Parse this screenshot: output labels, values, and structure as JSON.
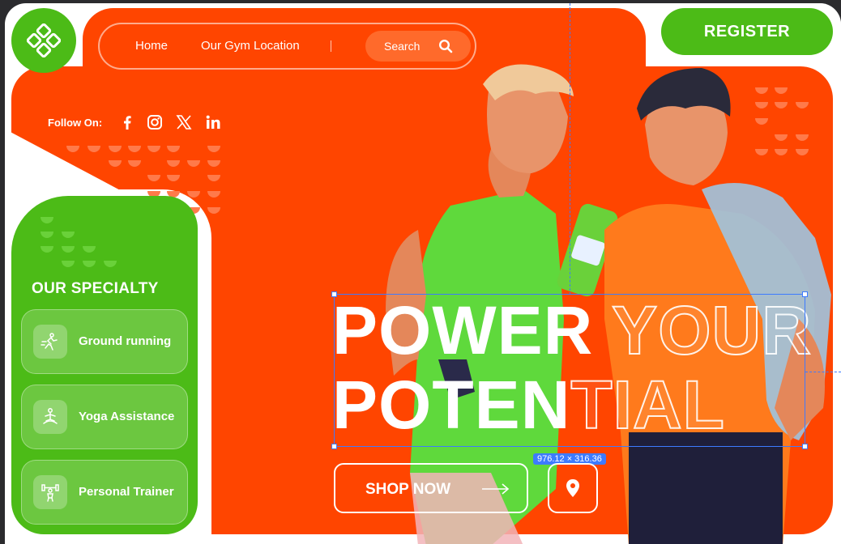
{
  "nav": {
    "home": "Home",
    "location": "Our Gym Location",
    "search_label": "Search"
  },
  "register_label": "REGISTER",
  "follow": {
    "label": "Follow On:",
    "icons": [
      "facebook-icon",
      "instagram-icon",
      "x-icon",
      "linkedin-icon"
    ]
  },
  "specialty": {
    "title": "OUR SPECIALTY",
    "items": [
      {
        "label": "Ground running",
        "icon": "running-icon"
      },
      {
        "label": "Yoga Assistance",
        "icon": "yoga-icon"
      },
      {
        "label": "Personal Trainer",
        "icon": "trainer-icon"
      }
    ]
  },
  "headline": {
    "line1_solid": "POWER",
    "line1_outline": "YOUR",
    "line2_solid": "POTEN",
    "line2_outline": "TIAL"
  },
  "selection": {
    "size_label": "976.12 × 316.36"
  },
  "cta": {
    "shop_label": "SHOP NOW"
  },
  "colors": {
    "orange": "#ff4500",
    "green": "#4cbb17",
    "selection": "#3d7bff"
  }
}
